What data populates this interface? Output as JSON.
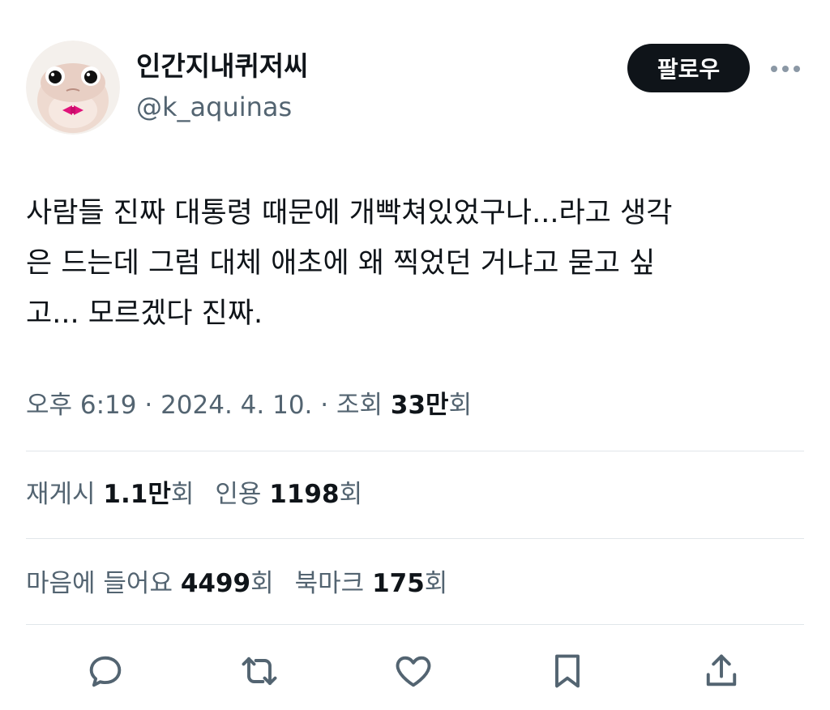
{
  "author": {
    "display_name": "인간지내퀴저씨",
    "handle": "@k_aquinas",
    "avatar_icon": "frog-avatar-icon"
  },
  "header": {
    "follow_label": "팔로우",
    "more_icon": "more-dots-icon"
  },
  "tweet": {
    "lines": [
      "사람들 진짜 대통령 때문에 개빡쳐있었구나...라고 생각",
      "은 드는데 그럼 대체 애초에 왜 찍었던 거냐고 묻고 싶",
      "고... 모르겠다 진짜."
    ]
  },
  "meta": {
    "time": "오후 6:19",
    "sep1": " · ",
    "date": "2024. 4. 10.",
    "sep2": " · ",
    "views_label": "조회 ",
    "views_count": "33만",
    "views_suffix": "회"
  },
  "stats": {
    "retweets_label": "재게시 ",
    "retweets_count": "1.1만",
    "retweets_suffix": "회",
    "quotes_label": "인용 ",
    "quotes_count": "1198",
    "quotes_suffix": "회",
    "likes_label": "마음에 들어요 ",
    "likes_count": "4499",
    "likes_suffix": "회",
    "bookmarks_label": "북마크 ",
    "bookmarks_count": "175",
    "bookmarks_suffix": "회"
  },
  "actions": {
    "reply_icon": "reply-icon",
    "retweet_icon": "retweet-icon",
    "like_icon": "heart-icon",
    "bookmark_icon": "bookmark-icon",
    "share_icon": "share-icon"
  },
  "colors": {
    "text_primary": "#0f1419",
    "text_secondary": "#536471",
    "divider": "#e1e6ea",
    "follow_bg": "#0f1419",
    "follow_text": "#ffffff",
    "bow_tie": "#e0137a"
  }
}
